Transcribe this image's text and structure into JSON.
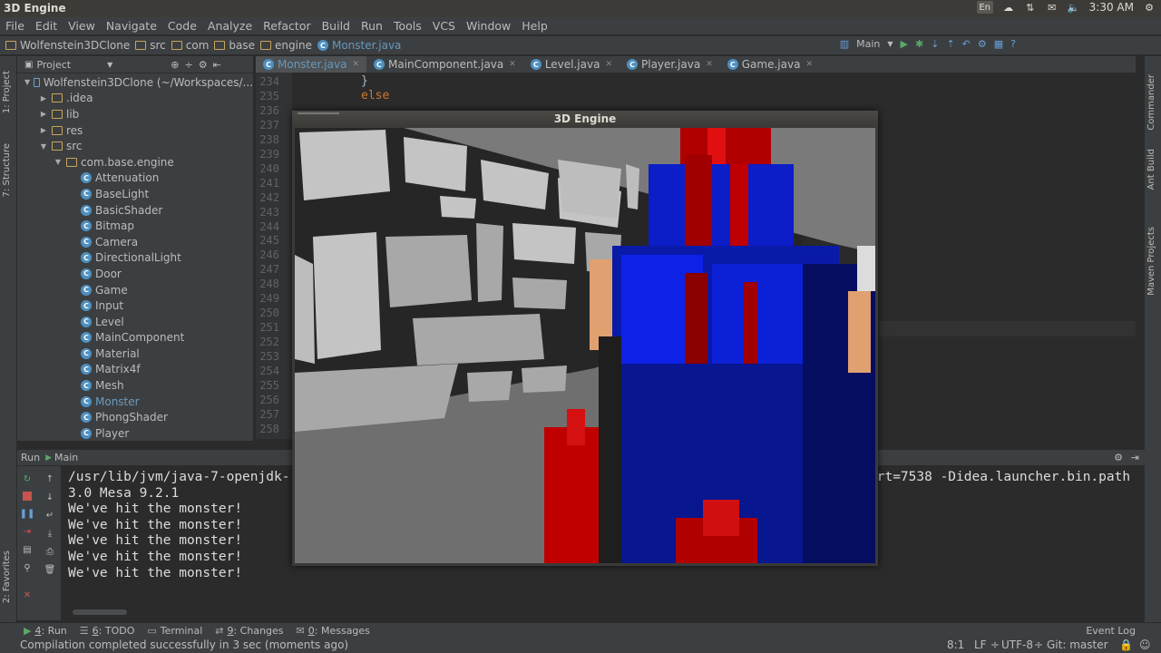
{
  "system": {
    "title": "3D Engine",
    "lang": "En",
    "time": "3:30 AM"
  },
  "menu": [
    "File",
    "Edit",
    "View",
    "Navigate",
    "Code",
    "Analyze",
    "Refactor",
    "Build",
    "Run",
    "Tools",
    "VCS",
    "Window",
    "Help"
  ],
  "breadcrumbs": [
    "Wolfenstein3DClone",
    "src",
    "com",
    "base",
    "engine",
    "Monster.java"
  ],
  "run_config": "Main",
  "project_panel": {
    "title": "Project",
    "tree": [
      {
        "label": "Wolfenstein3DClone (~/Workspaces/...",
        "level": 0,
        "kind": "module",
        "open": true
      },
      {
        "label": ".idea",
        "level": 1,
        "kind": "folder"
      },
      {
        "label": "lib",
        "level": 1,
        "kind": "folder"
      },
      {
        "label": "res",
        "level": 1,
        "kind": "folder"
      },
      {
        "label": "src",
        "level": 1,
        "kind": "folder",
        "open": true
      },
      {
        "label": "com.base.engine",
        "level": 2,
        "kind": "package",
        "open": true
      },
      {
        "label": "Attenuation",
        "level": 3,
        "kind": "class"
      },
      {
        "label": "BaseLight",
        "level": 3,
        "kind": "class"
      },
      {
        "label": "BasicShader",
        "level": 3,
        "kind": "class"
      },
      {
        "label": "Bitmap",
        "level": 3,
        "kind": "class"
      },
      {
        "label": "Camera",
        "level": 3,
        "kind": "class"
      },
      {
        "label": "DirectionalLight",
        "level": 3,
        "kind": "class"
      },
      {
        "label": "Door",
        "level": 3,
        "kind": "class"
      },
      {
        "label": "Game",
        "level": 3,
        "kind": "class"
      },
      {
        "label": "Input",
        "level": 3,
        "kind": "class"
      },
      {
        "label": "Level",
        "level": 3,
        "kind": "class"
      },
      {
        "label": "MainComponent",
        "level": 3,
        "kind": "class"
      },
      {
        "label": "Material",
        "level": 3,
        "kind": "class"
      },
      {
        "label": "Matrix4f",
        "level": 3,
        "kind": "class"
      },
      {
        "label": "Mesh",
        "level": 3,
        "kind": "class"
      },
      {
        "label": "Monster",
        "level": 3,
        "kind": "class",
        "selected": true
      },
      {
        "label": "PhongShader",
        "level": 3,
        "kind": "class"
      },
      {
        "label": "Player",
        "level": 3,
        "kind": "class"
      }
    ]
  },
  "side_tools": {
    "left_top": "1: Project",
    "left_mid": "7: Structure",
    "left_bottom": "2: Favorites",
    "right": [
      "Commander",
      "Ant Build",
      "Maven Projects"
    ]
  },
  "editor": {
    "tabs": [
      {
        "label": "Monster.java",
        "active": true
      },
      {
        "label": "MainComponent.java"
      },
      {
        "label": "Level.java"
      },
      {
        "label": "Player.java"
      },
      {
        "label": "Game.java"
      }
    ],
    "line_numbers": [
      "234",
      "235",
      "236",
      "237",
      "238",
      "239",
      "240",
      "241",
      "242",
      "243",
      "244",
      "245",
      "246",
      "247",
      "248",
      "249",
      "250",
      "251",
      "252",
      "253",
      "254",
      "255",
      "256",
      "257",
      "258"
    ],
    "code_line_1": "}",
    "code_line_2": "else"
  },
  "run_panel": {
    "label": "Run",
    "config": "Main",
    "console": [
      "/usr/lib/jvm/java-7-openjdk-",
      "3.0 Mesa 9.2.1",
      "We've hit the monster!",
      "We've hit the monster!",
      "We've hit the monster!",
      "We've hit the monster!",
      "We've hit the monster!"
    ],
    "console_right": "ort=7538 -Didea.launcher.bin.path"
  },
  "bottom_tools": [
    {
      "key": "4",
      "label": ": Run"
    },
    {
      "key": "6",
      "label": ": TODO"
    },
    {
      "key": "",
      "label": "Terminal"
    },
    {
      "key": "9",
      "label": ": Changes"
    },
    {
      "key": "0",
      "label": ": Messages"
    }
  ],
  "event_log": "Event Log",
  "status": {
    "message": "Compilation completed successfully in 3 sec (moments ago)",
    "position": "8:1",
    "line_sep": "LF",
    "encoding": "UTF-8",
    "vcs": "Git: master"
  },
  "game_window": {
    "title": "3D Engine"
  },
  "colors": {
    "accent": "#6897bb",
    "ide_bg": "#2b2b2b",
    "panel_bg": "#3c3f41",
    "monster_blue": "#0a1ee0",
    "monster_red": "#c00000"
  }
}
